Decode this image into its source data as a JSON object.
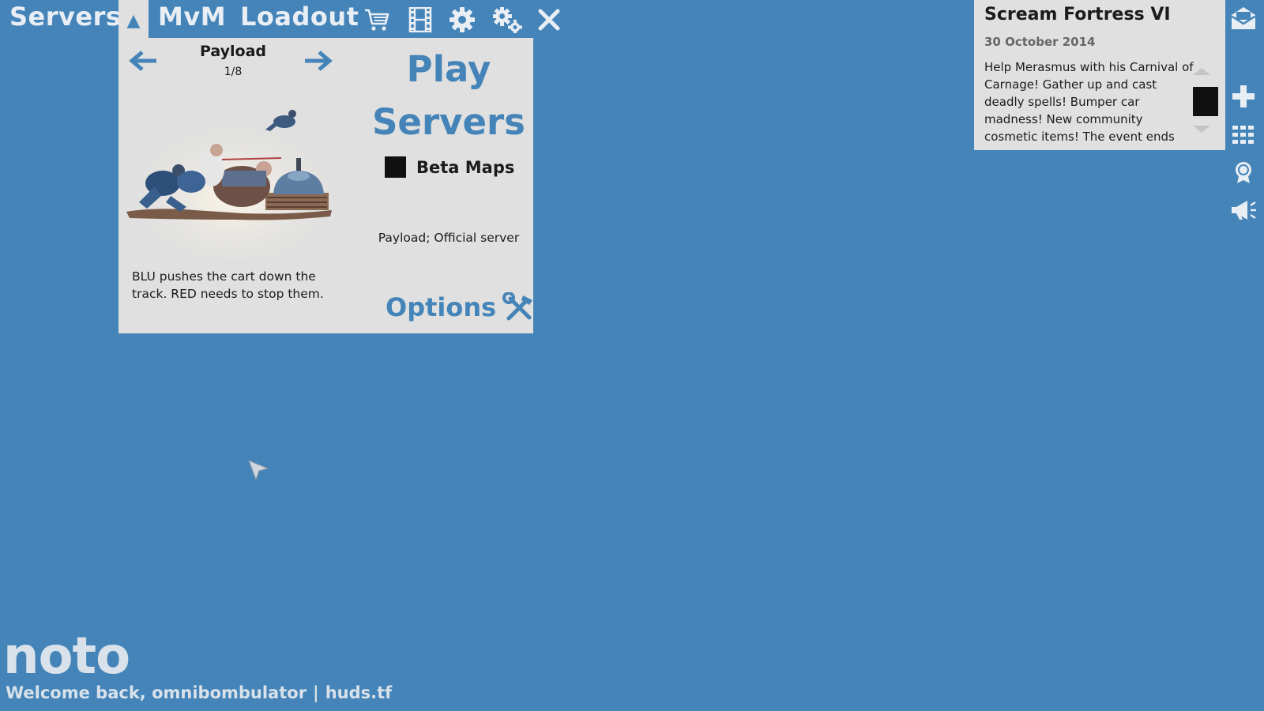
{
  "topnav": {
    "servers_label": "Servers",
    "toggle_glyph": "▲",
    "mvm_label": "MvM",
    "loadout_label": "Loadout",
    "icons": [
      "cart-icon",
      "film-icon",
      "gear-icon",
      "advanced-gears-icon",
      "close-icon"
    ]
  },
  "mode_panel": {
    "mode_title": "Payload",
    "page_indicator": "1/8",
    "description": "BLU pushes the cart down the track. RED needs to stop them.",
    "play_label": "Play",
    "servers_label": "Servers",
    "beta_label": "Beta Maps",
    "server_type": "Payload; Official server",
    "options_label": "Options"
  },
  "news": {
    "title": "Scream Fortress VI",
    "date": "30 October 2014",
    "body": "Help Merasmus with his Carnival of Carnage! Gather up and cast deadly spells! Bumper car madness! New community cosmetic items! The event ends"
  },
  "sidebar_icons": [
    "mail-icon",
    "plus-icon",
    "grid-icon",
    "achievement-icon",
    "megaphone-icon"
  ],
  "footer": {
    "hud_name": "noto",
    "welcome": "Welcome back, omnibombulator",
    "separator": "|",
    "site": "huds.tf"
  },
  "colors": {
    "background": "#4484b8",
    "panel": "#e0e0e0",
    "accent": "#4484b8",
    "text_dark": "#1b1b1b",
    "text_light": "#e8eef4"
  }
}
